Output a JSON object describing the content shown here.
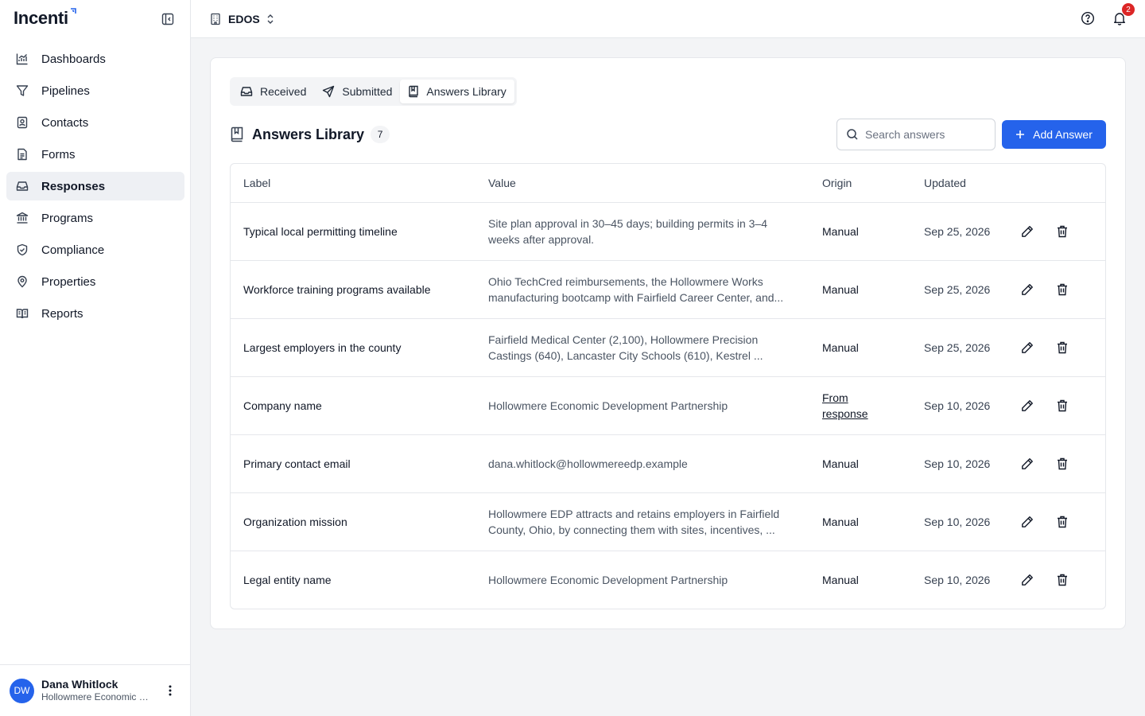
{
  "brand": {
    "name": "Incenti"
  },
  "nav": {
    "items": [
      {
        "label": "Dashboards",
        "icon": "chart-icon"
      },
      {
        "label": "Pipelines",
        "icon": "filter-icon"
      },
      {
        "label": "Contacts",
        "icon": "contact-book-icon"
      },
      {
        "label": "Forms",
        "icon": "document-icon"
      },
      {
        "label": "Responses",
        "icon": "inbox-icon",
        "active": true
      },
      {
        "label": "Programs",
        "icon": "bank-icon"
      },
      {
        "label": "Compliance",
        "icon": "shield-check-icon"
      },
      {
        "label": "Properties",
        "icon": "map-pin-icon"
      },
      {
        "label": "Reports",
        "icon": "book-open-icon"
      }
    ]
  },
  "user": {
    "initials": "DW",
    "name": "Dana Whitlock",
    "org": "Hollowmere Economic Development Partnership"
  },
  "topbar": {
    "org_name": "EDOS",
    "notification_count": "2"
  },
  "tabs": [
    {
      "label": "Received",
      "icon": "inbox-icon"
    },
    {
      "label": "Submitted",
      "icon": "send-icon"
    },
    {
      "label": "Answers Library",
      "icon": "bookmark-book-icon",
      "active": true
    }
  ],
  "section": {
    "title": "Answers Library",
    "count": "7"
  },
  "search": {
    "placeholder": "Search answers",
    "value": ""
  },
  "add_button": {
    "label": "Add Answer"
  },
  "table": {
    "columns": [
      "Label",
      "Value",
      "Origin",
      "Updated"
    ],
    "rows": [
      {
        "label": "Typical local permitting timeline",
        "value": "Site plan approval in 30–45 days; building permits in 3–4 weeks after approval.",
        "origin": "Manual",
        "updated": "Sep 25, 2026"
      },
      {
        "label": "Workforce training programs available",
        "value": "Ohio TechCred reimbursements, the Hollowmere Works manufacturing bootcamp with Fairfield Career Center, and...",
        "origin": "Manual",
        "updated": "Sep 25, 2026"
      },
      {
        "label": "Largest employers in the county",
        "value": "Fairfield Medical Center (2,100), Hollowmere Precision Castings (640), Lancaster City Schools (610), Kestrel ...",
        "origin": "Manual",
        "updated": "Sep 25, 2026"
      },
      {
        "label": "Company name",
        "value": "Hollowmere Economic Development Partnership",
        "origin": "From response",
        "origin_link": true,
        "updated": "Sep 10, 2026"
      },
      {
        "label": "Primary contact email",
        "value": "dana.whitlock@hollowmereedp.example",
        "origin": "Manual",
        "updated": "Sep 10, 2026"
      },
      {
        "label": "Organization mission",
        "value": "Hollowmere EDP attracts and retains employers in Fairfield County, Ohio, by connecting them with sites, incentives, ...",
        "origin": "Manual",
        "updated": "Sep 10, 2026"
      },
      {
        "label": "Legal entity name",
        "value": "Hollowmere Economic Development Partnership",
        "origin": "Manual",
        "updated": "Sep 10, 2026"
      }
    ]
  },
  "colors": {
    "accent": "#2563eb",
    "badge": "#dc2626",
    "active_nav_bg": "#eef0f4"
  }
}
